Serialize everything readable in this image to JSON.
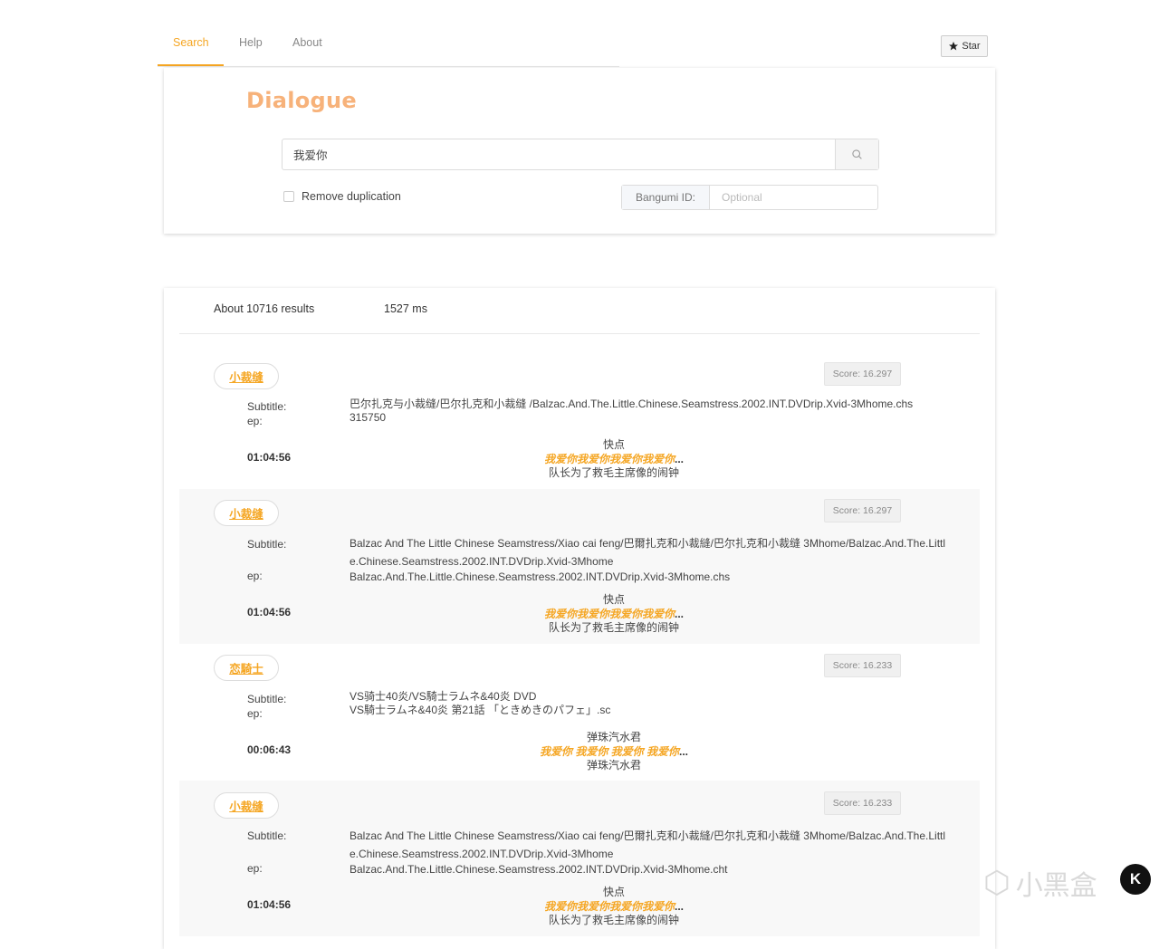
{
  "nav": {
    "tabs": [
      {
        "label": "Search",
        "active": true
      },
      {
        "label": "Help",
        "active": false
      },
      {
        "label": "About",
        "active": false
      }
    ],
    "star_label": "Star"
  },
  "search": {
    "title": "Dialogue",
    "query": "我爱你",
    "dedup_label": "Remove duplication",
    "bangumi_label": "Bangumi ID:",
    "bangumi_placeholder": "Optional"
  },
  "summary": {
    "count": "About 10716 results",
    "time": "1527 ms"
  },
  "labels": {
    "subtitle": "Subtitle:",
    "ep": "ep:"
  },
  "results": [
    {
      "title": "小裁缝",
      "score": "Score: 16.297",
      "subtitle": "巴尔扎克与小裁缝/巴尔扎克和小裁缝 /Balzac.And.The.Little.Chinese.Seamstress.2002.INT.DVDrip.Xvid-3Mhome.chs",
      "ep": "315750",
      "time": "01:04:56",
      "before": "快点",
      "match": "我爱你我爱你我爱你我爱你",
      "ellipsis": "...",
      "after": "队长为了救毛主席像的闹钟"
    },
    {
      "title": "小裁缝",
      "score": "Score: 16.297",
      "subtitle": "Balzac And The Little Chinese Seamstress/Xiao cai feng/巴爾扎克和小裁縫/巴尔扎克和小裁缝 3Mhome/Balzac.And.The.Little.Chinese.Seamstress.2002.INT.DVDrip.Xvid-3Mhome",
      "ep": "Balzac.And.The.Little.Chinese.Seamstress.2002.INT.DVDrip.Xvid-3Mhome.chs",
      "time": "01:04:56",
      "before": "快点",
      "match": "我爱你我爱你我爱你我爱你",
      "ellipsis": "...",
      "after": "队长为了救毛主席像的闹钟"
    },
    {
      "title": "恋騎士",
      "score": "Score: 16.233",
      "subtitle": "VS骑士40炎/VS騎士ラムネ&40炎 DVD",
      "ep": "VS騎士ラムネ&40炎 第21話 「ときめきのパフェ」.sc",
      "time": "00:06:43",
      "before": "弹珠汽水君",
      "match": "我爱你 我爱你 我爱你 我爱你",
      "ellipsis": "...",
      "after": "弹珠汽水君"
    },
    {
      "title": "小裁缝",
      "score": "Score: 16.233",
      "subtitle": "Balzac And The Little Chinese Seamstress/Xiao cai feng/巴爾扎克和小裁縫/巴尔扎克和小裁缝 3Mhome/Balzac.And.The.Little.Chinese.Seamstress.2002.INT.DVDrip.Xvid-3Mhome",
      "ep": "Balzac.And.The.Little.Chinese.Seamstress.2002.INT.DVDrip.Xvid-3Mhome.cht",
      "time": "01:04:56",
      "before": "快点",
      "match": "我爱你我爱你我爱你我爱你",
      "ellipsis": "...",
      "after": "队长为了救毛主席像的闹钟"
    }
  ],
  "watermark": {
    "text": "小黑盒",
    "logo": "K"
  },
  "colors": {
    "accent": "#f5a623",
    "title": "#f7b27a",
    "alt_row": "#f8f8f8"
  },
  "icons": [
    "star-icon",
    "search-icon",
    "heybox-logo-icon"
  ]
}
